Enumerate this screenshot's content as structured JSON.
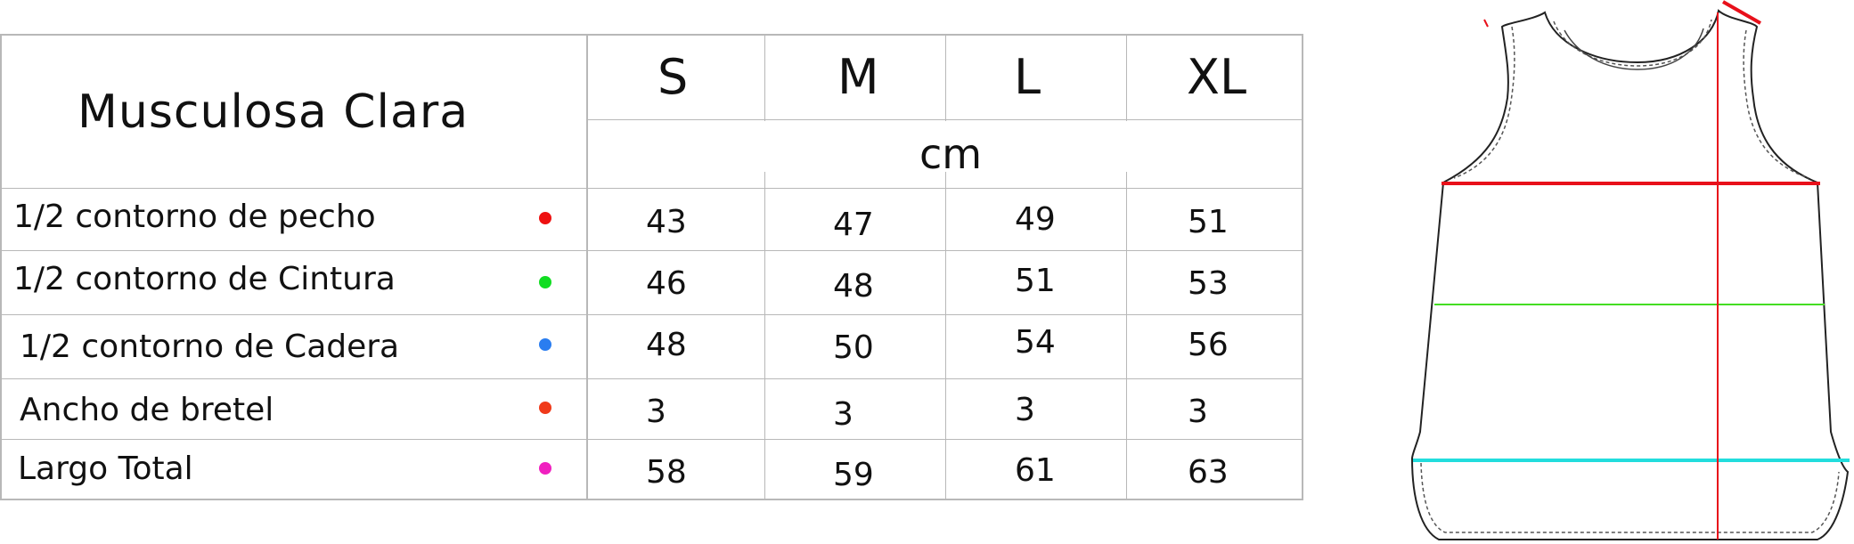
{
  "table": {
    "title": "Musculosa Clara",
    "unit": "cm",
    "sizes": [
      "S",
      "M",
      "L",
      "XL"
    ],
    "rows": [
      {
        "label": "1/2 contorno de pecho",
        "color": "#ee1111",
        "values": [
          "43",
          "47",
          "49",
          "51"
        ]
      },
      {
        "label": "1/2 contorno de Cintura",
        "color": "#11dd22",
        "values": [
          "46",
          "48",
          "51",
          "53"
        ]
      },
      {
        "label": "1/2 contorno de Cadera",
        "color": "#2a7df0",
        "values": [
          "48",
          "50",
          "54",
          "56"
        ]
      },
      {
        "label": "Ancho de bretel",
        "color": "#f03a1a",
        "values": [
          "3",
          "3",
          "3",
          "3"
        ]
      },
      {
        "label": "Largo Total",
        "color": "#f020c0",
        "values": [
          "58",
          "59",
          "61",
          "63"
        ]
      }
    ]
  },
  "garment": {
    "icon": "tank-top-icon",
    "measure_colors": {
      "chest": "#e8101a",
      "waist": "#44dd22",
      "hip": "#22dddd",
      "length": "#e8101a",
      "strap": "#e8101a"
    }
  }
}
